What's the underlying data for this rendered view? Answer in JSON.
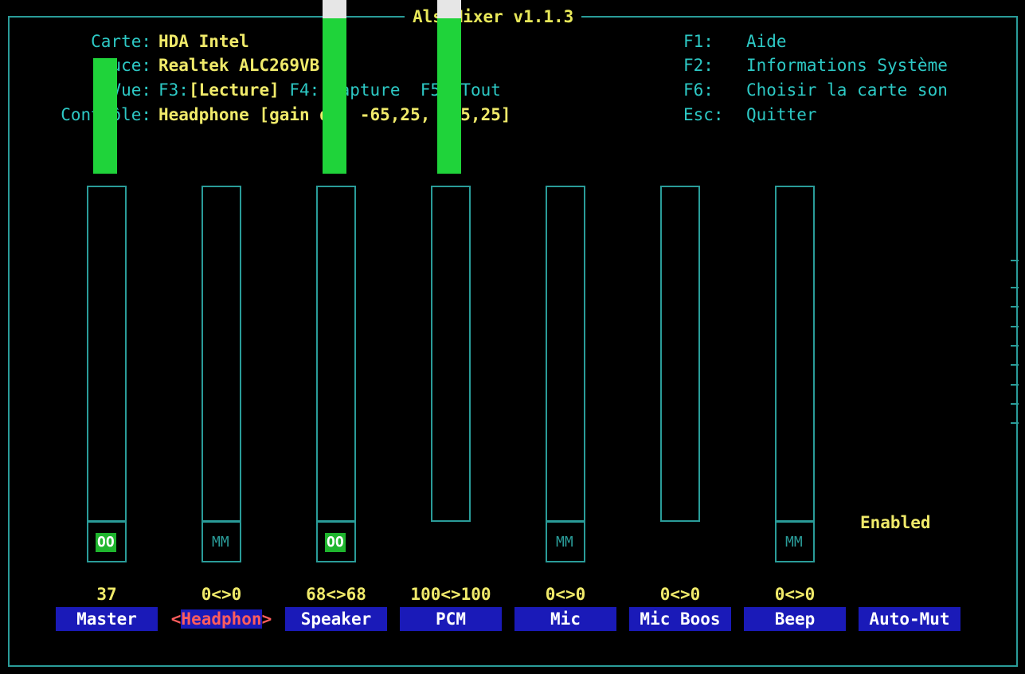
{
  "title": "AlsaMixer v1.1.3",
  "header": {
    "card_label": "Carte:",
    "card_value": "HDA Intel",
    "chip_label": "Puce:",
    "chip_value": "Realtek ALC269VB",
    "view_label": "Vue:",
    "view_f3": "F3:",
    "view_playback": "[Lecture]",
    "view_f4": "F4: Capture",
    "view_f5": "F5: Tout",
    "control_label": "Contrôle:",
    "control_value": "Headphone [gain dB: -65,25, -65,25]"
  },
  "keys": [
    {
      "key": "F1:",
      "action": "Aide"
    },
    {
      "key": "F2:",
      "action": "Informations Système"
    },
    {
      "key": "F6:",
      "action": "Choisir la carte son"
    },
    {
      "key": "Esc:",
      "action": "Quitter"
    }
  ],
  "channels": [
    {
      "name": "Master",
      "volume": "37",
      "level": 0.37,
      "switch": "OO"
    },
    {
      "name": "Headphon",
      "volume": "0<>0",
      "level": 0,
      "switch": "MM",
      "selected": true,
      "sel_left": "<",
      "sel_right": ">"
    },
    {
      "name": "Speaker",
      "volume": "68<>68",
      "level": 0.68,
      "switch": "OO"
    },
    {
      "name": "PCM",
      "volume": "100<>100",
      "level": 1.0,
      "switch": ""
    },
    {
      "name": "Mic",
      "volume": "0<>0",
      "level": 0,
      "switch": "MM"
    },
    {
      "name": "Mic Boos",
      "volume": "0<>0",
      "level": 0,
      "switch": ""
    },
    {
      "name": "Beep",
      "volume": "0<>0",
      "level": 0,
      "switch": "MM"
    },
    {
      "name": "Auto-Mut",
      "volume": "",
      "level": null,
      "switch": ""
    }
  ],
  "auto_mute_value": "Enabled",
  "colors": {
    "border": "#2a9c99",
    "label": "#2dc9c5",
    "value": "#f0ea6a",
    "bar_green": "#1fd33a",
    "bar_white": "#e6e6e6",
    "bar_red": "#e03020",
    "name_bg": "#1a1ab8"
  }
}
